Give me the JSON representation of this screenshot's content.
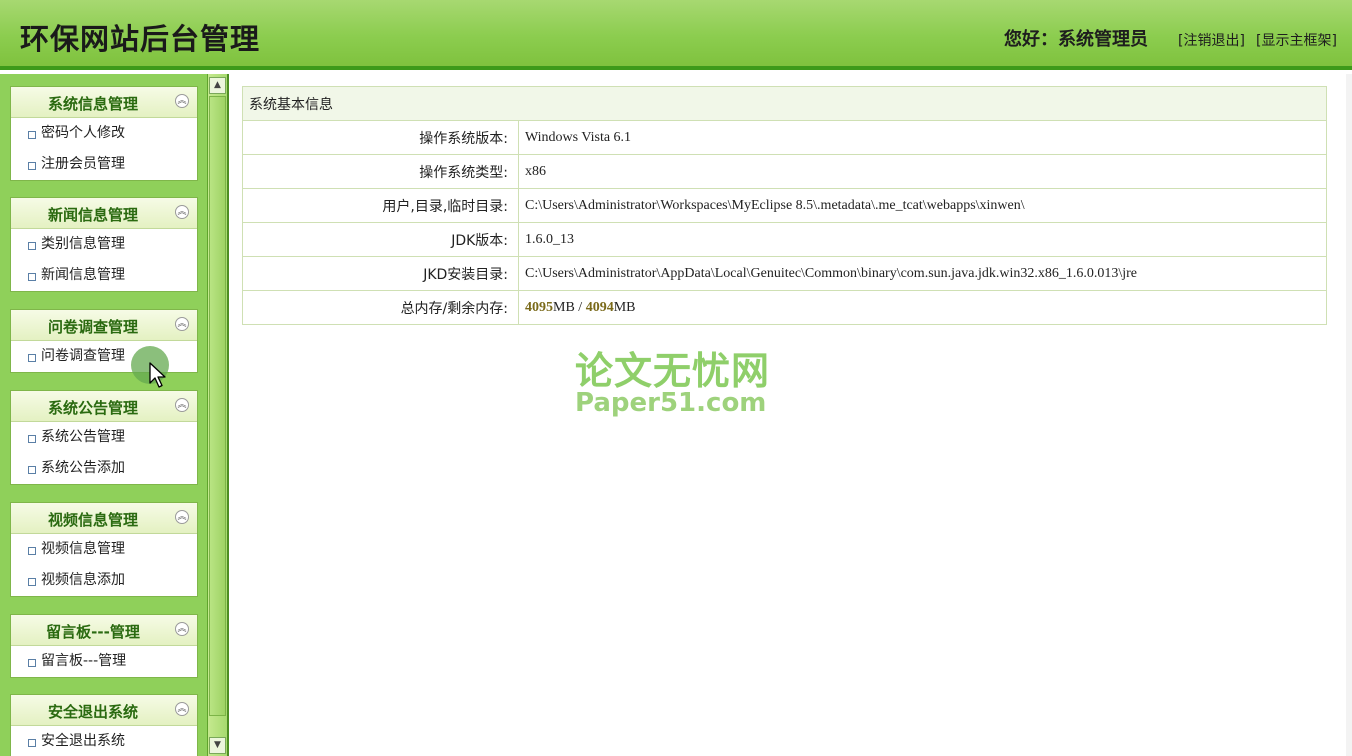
{
  "header": {
    "title": "环保网站后台管理",
    "greeting": "您好：系统管理员",
    "logout": "[注销退出]",
    "show_frame": "[显示主框架]"
  },
  "sidebar": {
    "panels": [
      {
        "title": "系统信息管理",
        "items": [
          "密码个人修改",
          "注册会员管理"
        ]
      },
      {
        "title": "新闻信息管理",
        "items": [
          "类别信息管理",
          "新闻信息管理"
        ]
      },
      {
        "title": "问卷调查管理",
        "items": [
          "问卷调查管理"
        ]
      },
      {
        "title": "系统公告管理",
        "items": [
          "系统公告管理",
          "系统公告添加"
        ]
      },
      {
        "title": "视频信息管理",
        "items": [
          "视频信息管理",
          "视频信息添加"
        ]
      },
      {
        "title": "留言板---管理",
        "items": [
          "留言板---管理"
        ]
      },
      {
        "title": "安全退出系统",
        "items": [
          "安全退出系统"
        ]
      }
    ],
    "collapse_glyph": "︽"
  },
  "main": {
    "caption": "系统基本信息",
    "rows": [
      {
        "label": "操作系统版本:",
        "value": "Windows Vista  6.1"
      },
      {
        "label": "操作系统类型:",
        "value": "x86"
      },
      {
        "label": "用户,目录,临时目录:",
        "value": "C:\\Users\\Administrator\\Workspaces\\MyEclipse 8.5\\.metadata\\.me_tcat\\webapps\\xinwen\\"
      },
      {
        "label": "JDK版本:",
        "value": "1.6.0_13"
      },
      {
        "label": "JKD安装目录:",
        "value": "C:\\Users\\Administrator\\AppData\\Local\\Genuitec\\Common\\binary\\com.sun.java.jdk.win32.x86_1.6.0.013\\jre"
      }
    ],
    "memory": {
      "label": "总内存/剩余内存:",
      "total": "4095",
      "unit1": "MB",
      "sep": " / ",
      "free": "4094",
      "unit2": "MB"
    }
  },
  "watermark": {
    "cn": "论文无忧网",
    "en": "Paper51.com"
  },
  "colors": {
    "header_green": "#8ccd4f",
    "header_border": "#3d9a1a",
    "sidebar_bg": "#8fd05a",
    "panel_title": "#2a6a10"
  }
}
